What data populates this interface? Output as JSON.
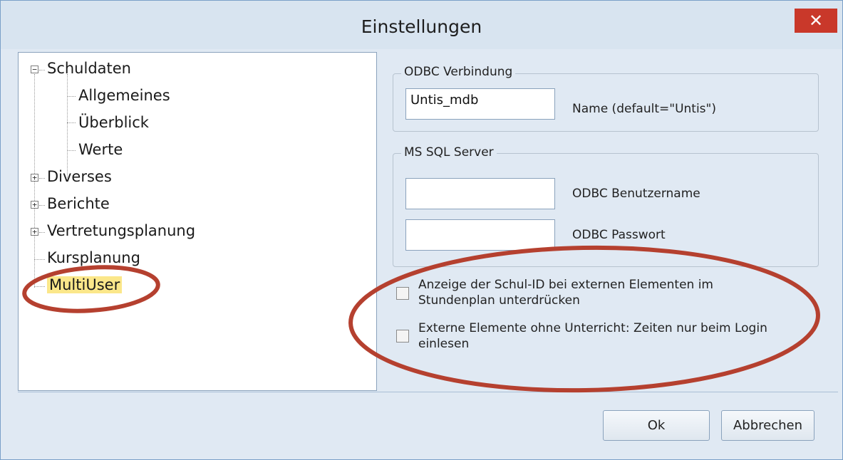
{
  "window": {
    "title": "Einstellungen",
    "close_glyph": "✕"
  },
  "tree": {
    "items": [
      {
        "label": "Schuldaten",
        "expander": "−",
        "children": [
          {
            "label": "Allgemeines"
          },
          {
            "label": "Überblick"
          },
          {
            "label": "Werte"
          }
        ]
      },
      {
        "label": "Diverses",
        "expander": "+"
      },
      {
        "label": "Berichte",
        "expander": "+"
      },
      {
        "label": "Vertretungsplanung",
        "expander": "+"
      },
      {
        "label": "Kursplanung"
      },
      {
        "label": "MultiUser",
        "selected": true
      }
    ]
  },
  "odbc_group": {
    "legend": "ODBC Verbindung",
    "name_value": "Untis_mdb",
    "name_label": "Name (default=\"Untis\")"
  },
  "sql_group": {
    "legend": "MS SQL Server",
    "username_value": "",
    "username_label": "ODBC Benutzername",
    "password_value": "",
    "password_label": "ODBC Passwort"
  },
  "checkboxes": [
    {
      "text": "Anzeige der Schul-ID bei externen Elementen im Stundenplan unterdrücken",
      "checked": false
    },
    {
      "text": "Externe Elemente ohne Unterricht: Zeiten nur beim Login einlesen",
      "checked": false
    }
  ],
  "buttons": {
    "ok": "Ok",
    "cancel": "Abbrechen"
  },
  "colors": {
    "annotation": "#b5402f",
    "selection_highlight": "#fbe78a",
    "close_button": "#c9382a"
  }
}
